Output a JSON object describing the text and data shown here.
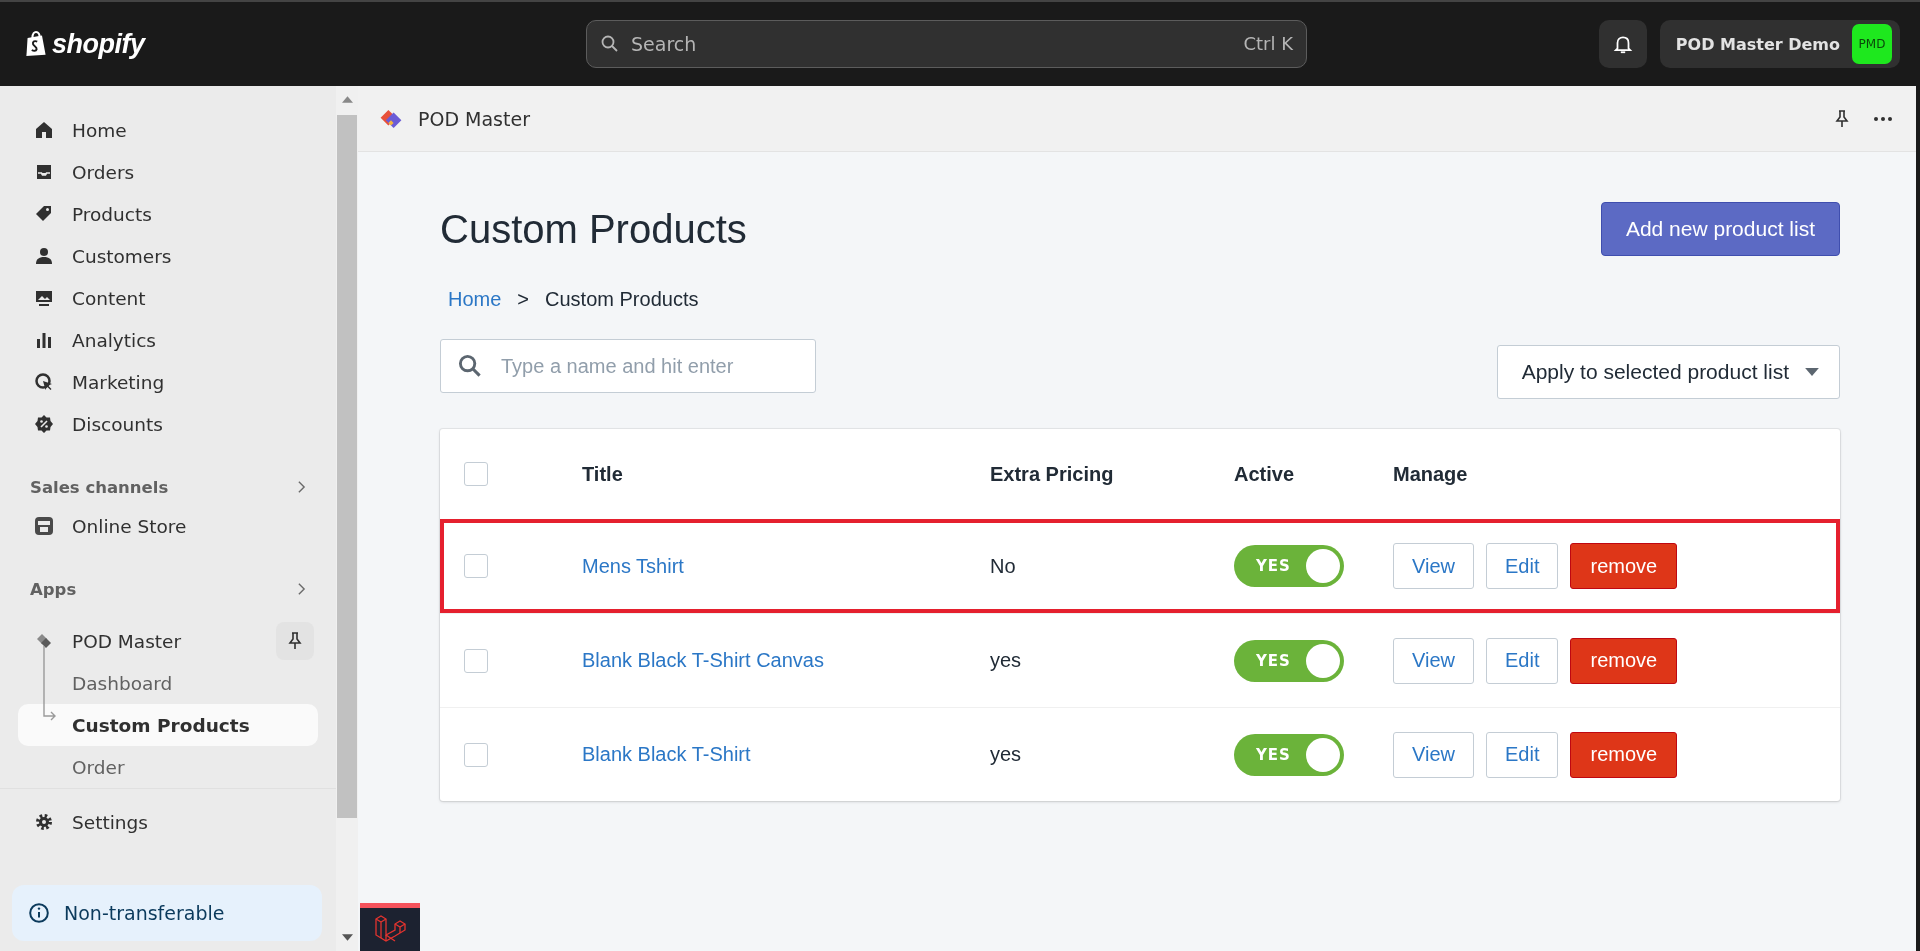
{
  "topbar": {
    "logo": "shopify",
    "search": {
      "placeholder": "Search",
      "shortcut": "Ctrl K"
    },
    "store": {
      "name": "POD Master Demo",
      "initials": "PMD"
    }
  },
  "sidebar": {
    "items": [
      {
        "label": "Home",
        "kind": "home"
      },
      {
        "label": "Orders",
        "kind": "orders"
      },
      {
        "label": "Products",
        "kind": "products"
      },
      {
        "label": "Customers",
        "kind": "customers"
      },
      {
        "label": "Content",
        "kind": "content"
      },
      {
        "label": "Analytics",
        "kind": "analytics"
      },
      {
        "label": "Marketing",
        "kind": "marketing"
      },
      {
        "label": "Discounts",
        "kind": "discounts"
      }
    ],
    "sections": [
      {
        "title": "Sales channels",
        "items": [
          {
            "label": "Online Store",
            "kind": "store"
          }
        ]
      },
      {
        "title": "Apps",
        "items": [
          {
            "label": "POD Master",
            "kind": "app",
            "children": [
              {
                "label": "Dashboard",
                "selected": false
              },
              {
                "label": "Custom Products",
                "selected": true
              },
              {
                "label": "Order",
                "selected": false
              }
            ]
          }
        ]
      }
    ],
    "settings": "Settings",
    "notice": "Non-transferable"
  },
  "app_header": {
    "title": "POD Master"
  },
  "page": {
    "title": "Custom Products",
    "primary_button": "Add new product list",
    "breadcrumb": [
      {
        "label": "Home",
        "kind": "link"
      },
      {
        "label": ">",
        "kind": "separator"
      },
      {
        "label": "Custom Products",
        "kind": "current"
      }
    ],
    "search": {
      "placeholder": "Type a name and hit enter"
    },
    "bulk_action": "Apply to selected product list"
  },
  "table": {
    "columns": [
      "Title",
      "Extra Pricing",
      "Active",
      "Manage"
    ],
    "header_checked": false,
    "rows": [
      {
        "checked": false,
        "highlighted": true,
        "title": "Mens Tshirt",
        "extra_pricing": "No",
        "active": {
          "on": true,
          "label": "YES"
        },
        "actions": [
          {
            "label": "View",
            "kind": "outline"
          },
          {
            "label": "Edit",
            "kind": "outline"
          },
          {
            "label": "remove",
            "kind": "danger"
          }
        ]
      },
      {
        "checked": false,
        "highlighted": false,
        "title": "Blank Black T-Shirt Canvas",
        "extra_pricing": "yes",
        "active": {
          "on": true,
          "label": "YES"
        },
        "actions": [
          {
            "label": "View",
            "kind": "outline"
          },
          {
            "label": "Edit",
            "kind": "outline"
          },
          {
            "label": "remove",
            "kind": "danger"
          }
        ]
      },
      {
        "checked": false,
        "highlighted": false,
        "title": "Blank Black T-Shirt",
        "extra_pricing": "yes",
        "active": {
          "on": true,
          "label": "YES"
        },
        "actions": [
          {
            "label": "View",
            "kind": "outline"
          },
          {
            "label": "Edit",
            "kind": "outline"
          },
          {
            "label": "remove",
            "kind": "danger"
          }
        ]
      }
    ]
  }
}
